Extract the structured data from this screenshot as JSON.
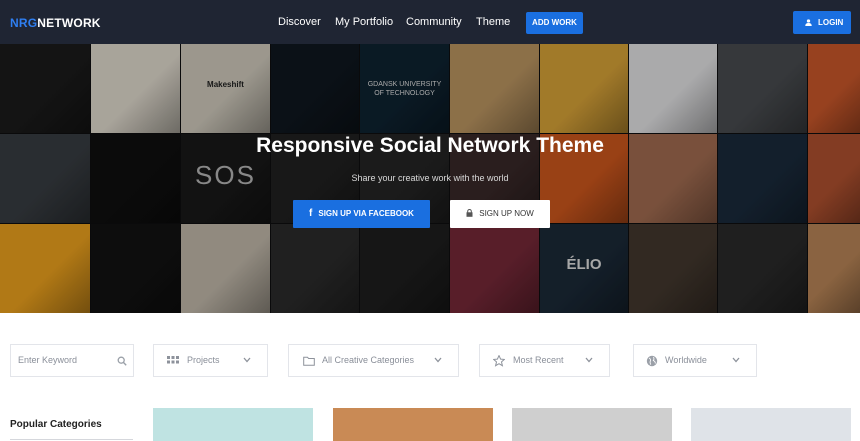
{
  "nav": {
    "logo_part1": "NRG",
    "logo_part2": "NETWORK",
    "links": [
      "Discover",
      "My Portfolio",
      "Community",
      "Theme"
    ],
    "add_work_label": "ADD WORK",
    "login_label": "LOGIN"
  },
  "hero": {
    "title": "Responsive Social Network Theme",
    "subtitle": "Share your creative work with the world",
    "facebook_button": "SIGN UP VIA FACEBOOK",
    "signup_button": "SIGN UP NOW",
    "tiles": [
      {
        "color": "#1c1c1c",
        "caption": ""
      },
      {
        "color": "#e9e3d6",
        "caption": ""
      },
      {
        "color": "#d8d2c4",
        "caption": "Makeshift"
      },
      {
        "color": "#101820",
        "caption": ""
      },
      {
        "color": "#0f2433",
        "caption": "GDANSK UNIVERSITY OF TECHNOLOGY"
      },
      {
        "color": "#c29b65",
        "caption": ""
      },
      {
        "color": "#e0a93a",
        "caption": ""
      },
      {
        "color": "#ececee",
        "caption": ""
      },
      {
        "color": "#4b4e52",
        "caption": ""
      },
      {
        "color": "#d25b2c",
        "caption": ""
      },
      {
        "color": "#3a3f44",
        "caption": ""
      },
      {
        "color": "#101010",
        "caption": ""
      },
      {
        "color": "#1a1a1a",
        "caption": "SOS"
      },
      {
        "color": "#222222",
        "caption": ""
      },
      {
        "color": "#262626",
        "caption": ""
      },
      {
        "color": "#3b2a2a",
        "caption": ""
      },
      {
        "color": "#d55a1e",
        "caption": ""
      },
      {
        "color": "#a87054",
        "caption": ""
      },
      {
        "color": "#1b2c3e",
        "caption": ""
      },
      {
        "color": "#b65431",
        "caption": ""
      },
      {
        "color": "#f6a81f",
        "caption": ""
      },
      {
        "color": "#131313",
        "caption": ""
      },
      {
        "color": "#c9c0b1",
        "caption": ""
      },
      {
        "color": "#2d2d2d",
        "caption": ""
      },
      {
        "color": "#1f1f1f",
        "caption": ""
      },
      {
        "color": "#7a2a3a",
        "caption": ""
      },
      {
        "color": "#1c2b3a",
        "caption": "ÉLIO"
      },
      {
        "color": "#463a30",
        "caption": ""
      },
      {
        "color": "#2b2b2b",
        "caption": ""
      },
      {
        "color": "#c08a5a",
        "caption": ""
      }
    ]
  },
  "filters": {
    "keyword_placeholder": "Enter Keyword",
    "projects": "Projects",
    "categories": "All Creative Categories",
    "sort": "Most Recent",
    "location": "Worldwide"
  },
  "sidebar": {
    "popular_title": "Popular Categories"
  },
  "cards": [
    {
      "color": "#bfe3e2"
    },
    {
      "color": "#c98a55"
    },
    {
      "color": "#cfcfcf"
    },
    {
      "color": "#dfe3e8"
    }
  ]
}
